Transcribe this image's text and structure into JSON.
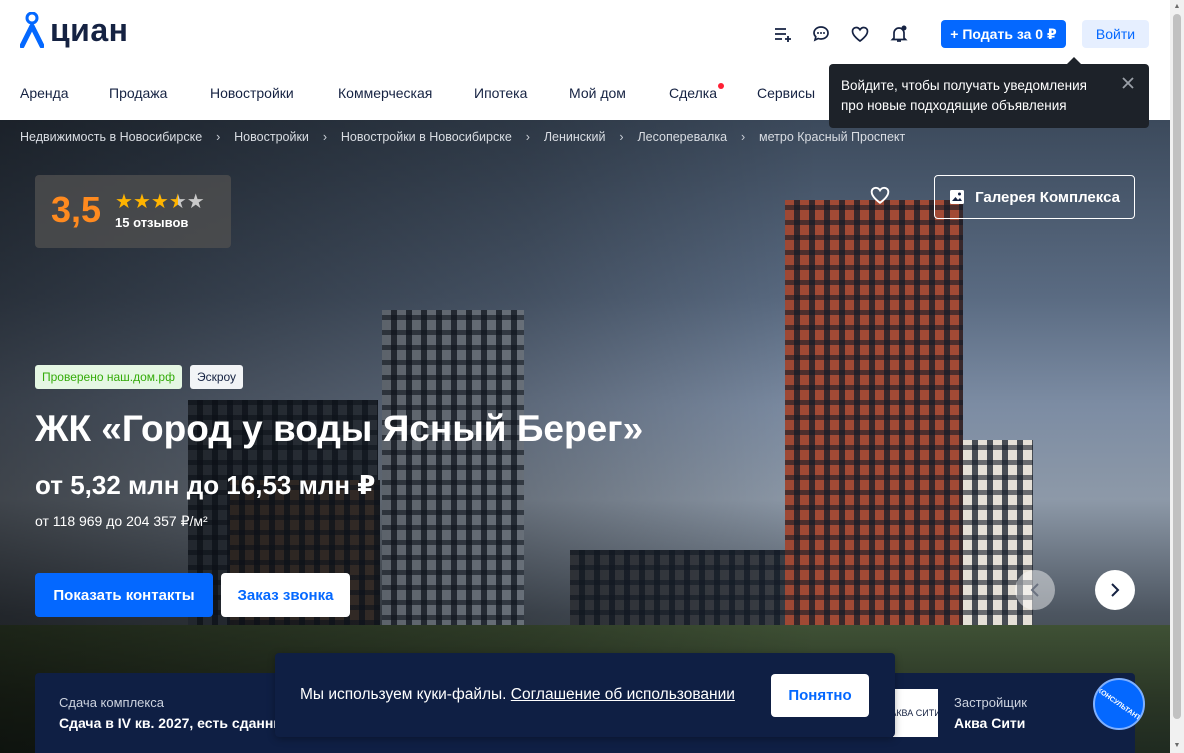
{
  "logo": {
    "text": "циан"
  },
  "header": {
    "post_button": "+ Подать за 0 ₽",
    "login_button": "Войти",
    "icons": [
      "compare-list-icon",
      "chat-icon",
      "favorites-heart-icon",
      "notifications-bell-icon"
    ]
  },
  "nav": {
    "items": [
      {
        "label": "Аренда"
      },
      {
        "label": "Продажа"
      },
      {
        "label": "Новостройки"
      },
      {
        "label": "Коммерческая"
      },
      {
        "label": "Ипотека"
      },
      {
        "label": "Мой дом"
      },
      {
        "label": "Сделка",
        "has_dot": true
      },
      {
        "label": "Сервисы"
      }
    ]
  },
  "tooltip": {
    "text": "Войдите, чтобы получать уведомления про новые подходящие объявления"
  },
  "breadcrumbs": [
    "Недвижимость в Новосибирске",
    "Новостройки",
    "Новостройки в Новосибирске",
    "Ленинский",
    "Лесоперевалка",
    "метро Красный Проспект"
  ],
  "rating": {
    "value": "3,5",
    "stars": 3.5,
    "reviews": "15 отзывов"
  },
  "gallery_button": "Галерея Комплекса",
  "badges": {
    "verified": "Проверено наш.дом.рф",
    "escrow": "Эскроу"
  },
  "complex": {
    "title": "ЖК «Город у воды Ясный Берег»",
    "price": "от 5,32 млн до 16,53 млн ₽",
    "price_per_m2": "от 118 969 до 204 357 ₽/м²"
  },
  "actions": {
    "show_contacts": "Показать контакты",
    "order_call": "Заказ звонка"
  },
  "info": {
    "completion_label": "Сдача комплекса",
    "completion_value": "Сдача в IV кв. 2027, есть сданные",
    "developer_label": "Застройщик",
    "developer_value": "Аква Сити",
    "developer_logo_text": "АКВА СИТИ"
  },
  "cookie": {
    "text": "Мы используем куки-файлы. ",
    "link": "Соглашение об использовании",
    "button": "Понятно"
  },
  "consultant": {
    "label": "КОНСУЛЬТАНТ"
  },
  "colors": {
    "brand_blue": "#0468ff",
    "dark_navy": "#0f1f44",
    "rating_orange": "#ff8a1f",
    "star_yellow": "#ffb400",
    "notification_red": "#ff1f34",
    "verified_green": "#34ac0a"
  }
}
